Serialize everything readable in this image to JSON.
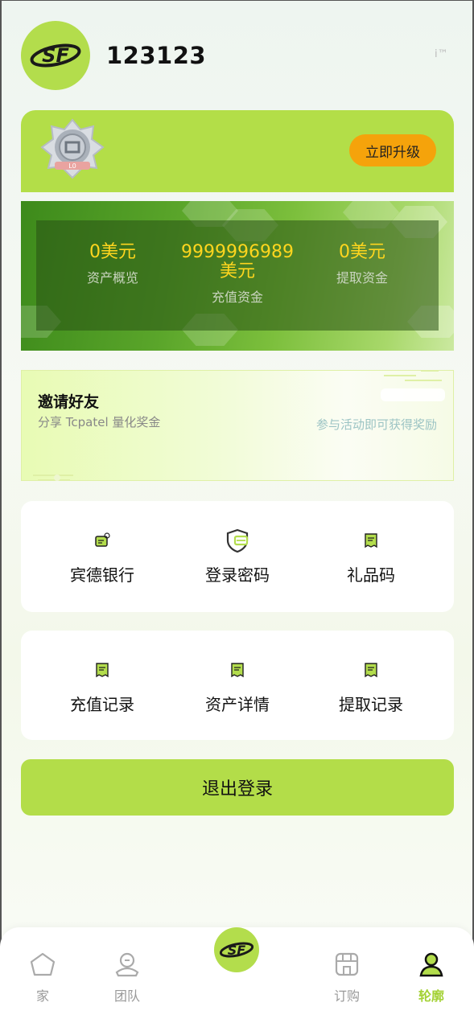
{
  "header": {
    "username": "123123",
    "logo_text": "SF",
    "tm_mark": "i™"
  },
  "vip": {
    "badge_level": "L0",
    "upgrade_label": "立即升级"
  },
  "assets": {
    "overview_value": "0美元",
    "overview_label": "资产概览",
    "recharge_value_line1": "9999996989",
    "recharge_value_line2": "美元",
    "recharge_label": "充值资金",
    "withdraw_value": "0美元",
    "withdraw_label": "提取资金"
  },
  "invite": {
    "title": "邀请好友",
    "subtitle": "分享 Tcpatel 量化奖金",
    "right_text": "参与活动即可获得奖励"
  },
  "menu_row1": [
    {
      "label": "宾德银行",
      "icon": "bank-card-icon"
    },
    {
      "label": "登录密码",
      "icon": "shield-password-icon"
    },
    {
      "label": "礼品码",
      "icon": "gift-code-icon"
    }
  ],
  "menu_row2": [
    {
      "label": "充值记录",
      "icon": "recharge-record-icon"
    },
    {
      "label": "资产详情",
      "icon": "asset-detail-icon"
    },
    {
      "label": "提取记录",
      "icon": "withdraw-record-icon"
    }
  ],
  "logout_label": "退出登录",
  "nav": {
    "home": "家",
    "team": "团队",
    "center_logo": "SF",
    "orders": "订购",
    "profile": "轮廓",
    "active": "profile"
  },
  "colors": {
    "accent": "#b3dd4c",
    "upgrade": "#f5a30b",
    "asset_value": "#ffd61e"
  }
}
